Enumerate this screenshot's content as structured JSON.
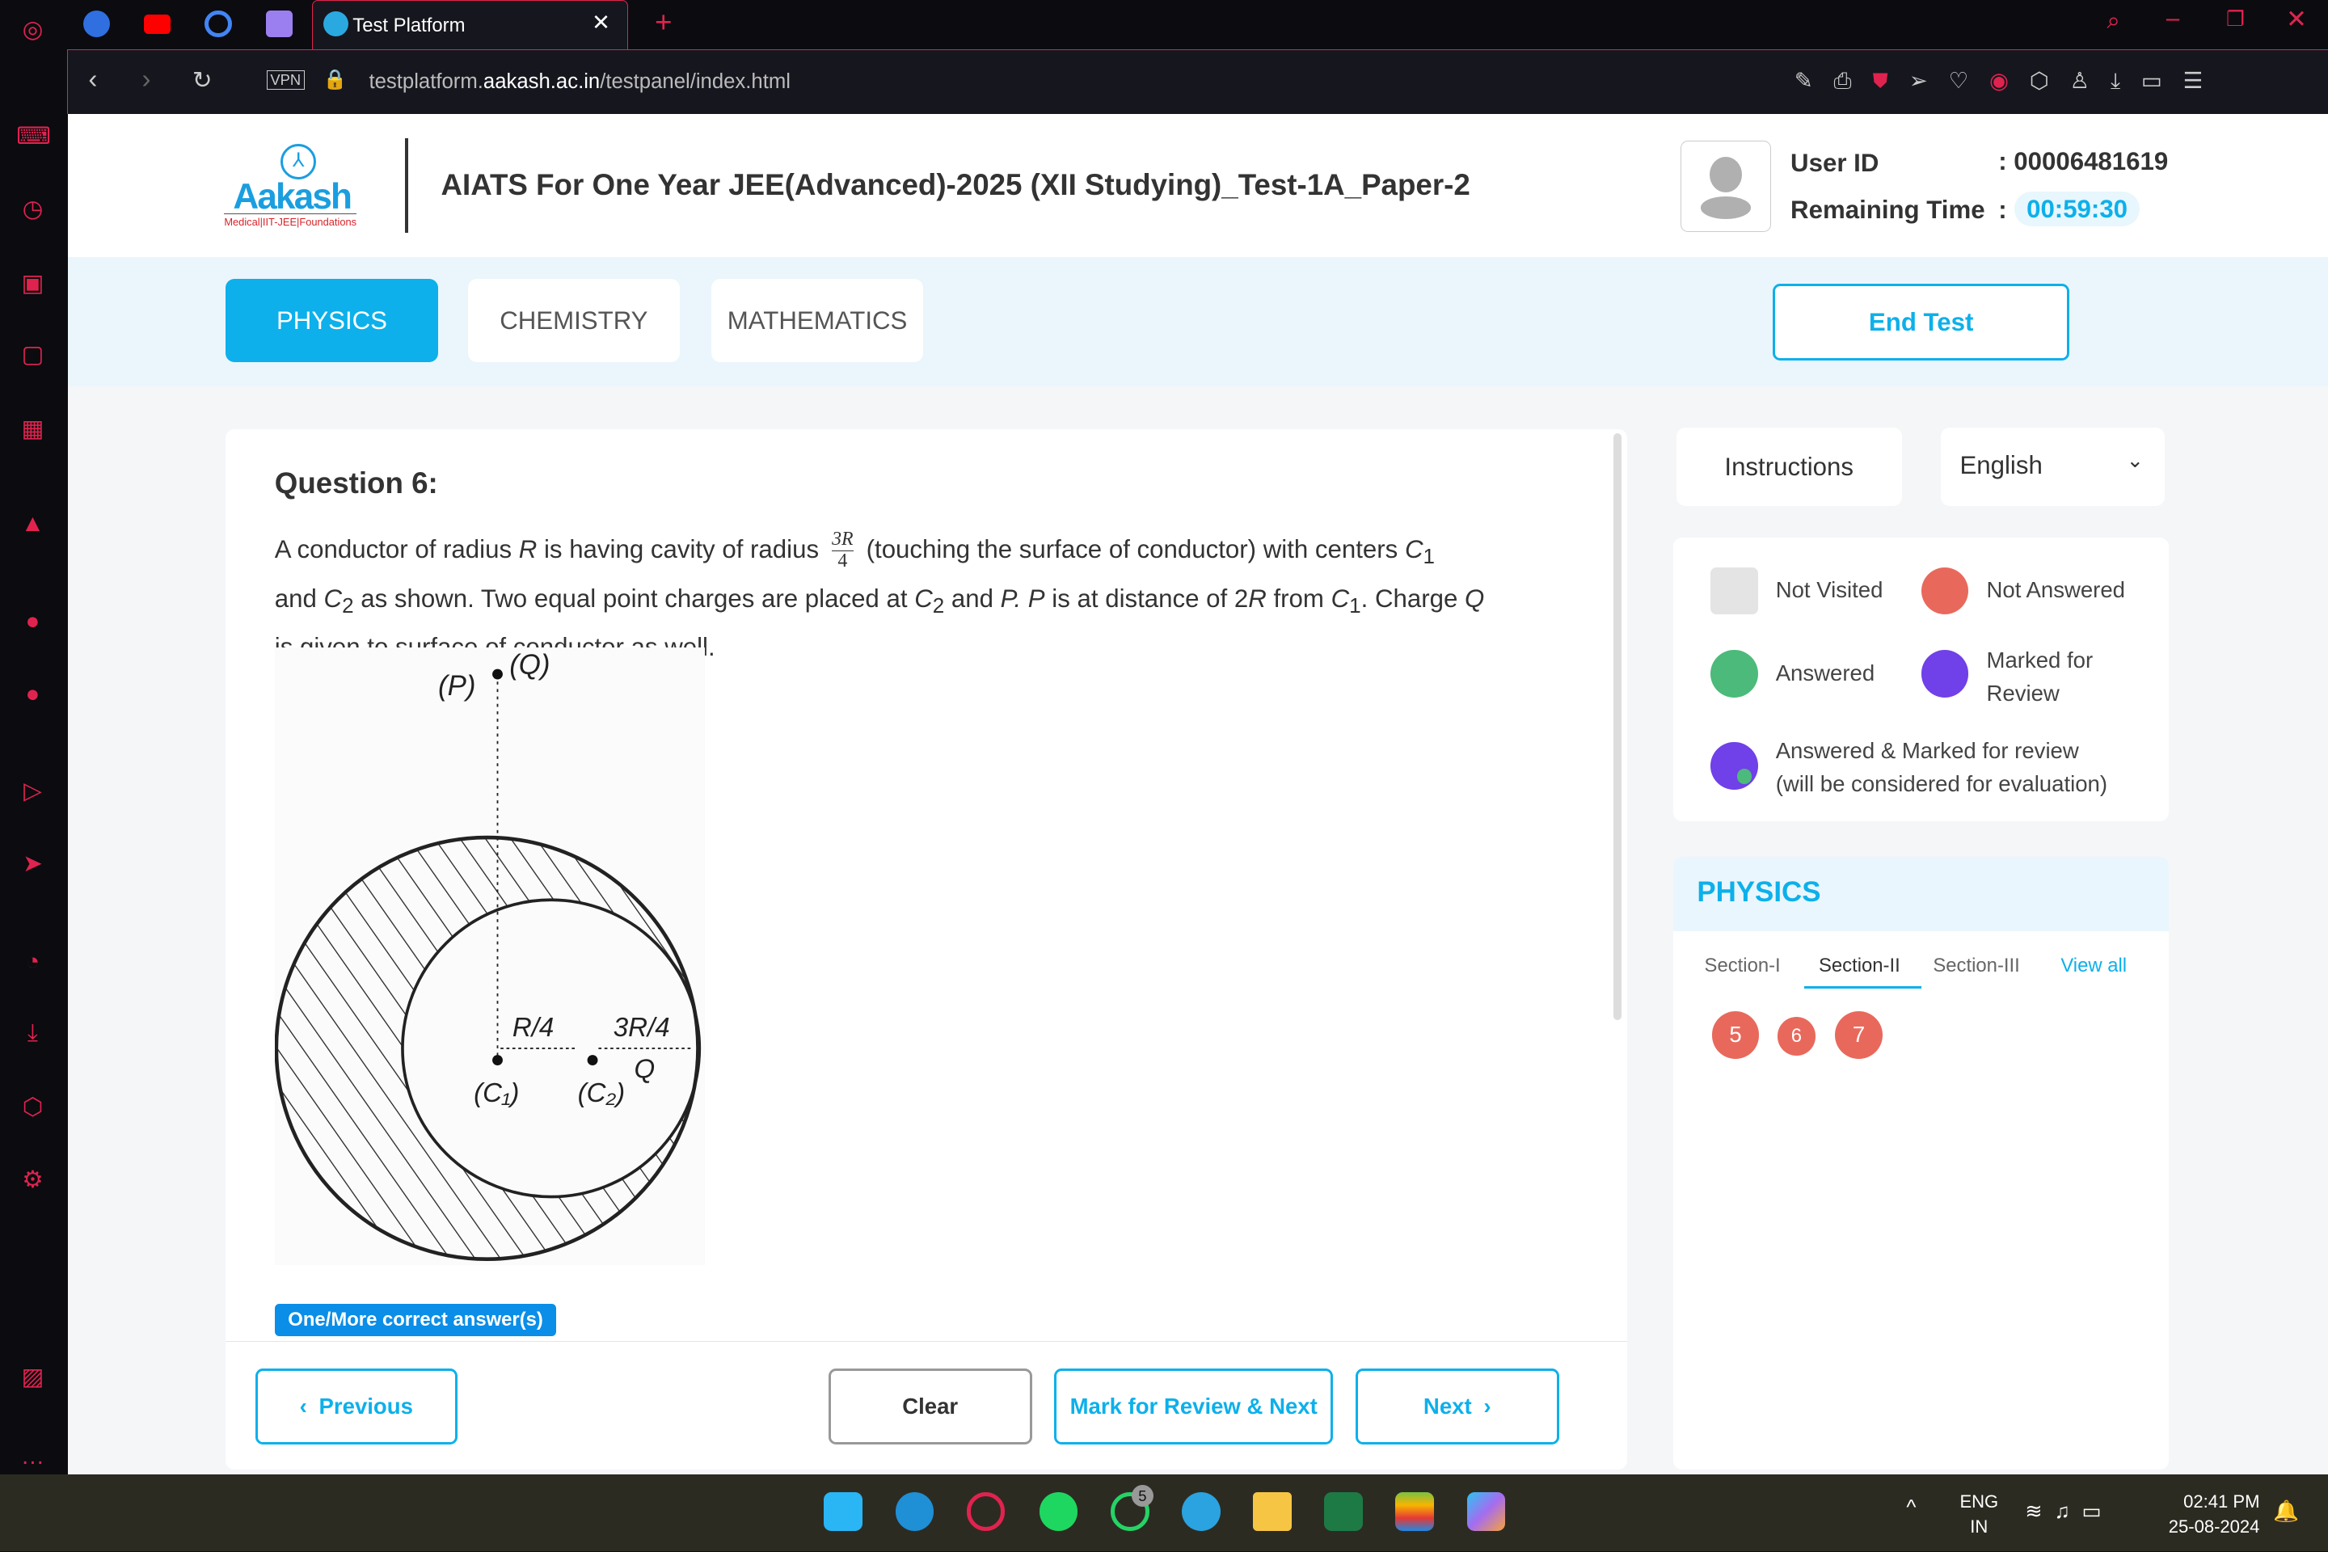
{
  "browser": {
    "tab_title": "Test Platform",
    "url_host": "testplatform.",
    "url_domain": "aakash.ac.in",
    "url_path": "/testpanel/index.html",
    "vpn_label": "VPN"
  },
  "header": {
    "logo_text": "Aakash",
    "logo_tagline": "Medical|IIT-JEE|Foundations",
    "title": "AIATS For One Year JEE(Advanced)-2025 (XII Studying)_Test-1A_Paper-2",
    "user_id_label": "User ID",
    "user_id_value": ": 00006481619",
    "remaining_label": "Remaining Time",
    "remaining_sep": ":",
    "remaining_value": "00:59:30"
  },
  "subjects": [
    {
      "label": "PHYSICS",
      "active": true
    },
    {
      "label": "CHEMISTRY",
      "active": false
    },
    {
      "label": "MATHEMATICS",
      "active": false
    }
  ],
  "end_test_label": "End Test",
  "question": {
    "title": "Question 6:",
    "text_1": "A conductor of radius ",
    "text_R": "R",
    "text_2": " is having cavity of radius ",
    "frac_num": "3R",
    "frac_den": "4",
    "text_3": " (touching the surface of conductor) with centers ",
    "text_C1": "C",
    "sub_1": "1",
    "text_and": "and ",
    "text_C2": "C",
    "sub_2": "2",
    "text_4": " as shown. Two equal point charges are placed at ",
    "text_C2b": "C",
    "sub_2b": "2",
    "text_5": " and ",
    "text_P": "P. P",
    "text_6": " is at distance of 2",
    "text_R2": "R",
    "text_7": " from ",
    "text_C1b": "C",
    "sub_1b": "1",
    "text_8": ". Charge ",
    "text_Q": "Q",
    "text_9": "is given to surface of conductor as well.",
    "diagram_labels": {
      "P": "(P)",
      "Q": "(Q)",
      "r4": "R/4",
      "r34": "3R/4",
      "c1": "(C₁)",
      "c2": "(C₂)",
      "q2": "Q"
    },
    "answer_type": "One/More correct answer(s)"
  },
  "nav": {
    "previous": "Previous",
    "clear": "Clear",
    "mark": "Mark for Review & Next",
    "next": "Next"
  },
  "right": {
    "instructions": "Instructions",
    "language": "English",
    "legend": {
      "not_visited": "Not Visited",
      "not_answered": "Not Answered",
      "answered": "Answered",
      "marked": "Marked for Review",
      "answered_marked": "Answered & Marked for review",
      "answered_marked_note": "(will be considered for evaluation)"
    },
    "palette_title": "PHYSICS",
    "sections": [
      "Section-I",
      "Section-II",
      "Section-III"
    ],
    "active_section": "Section-II",
    "view_all": "View all",
    "questions": [
      "5",
      "6",
      "7"
    ]
  },
  "colors": {
    "accent": "#0db0ea",
    "not_answered": "#e8695c",
    "answered": "#4cba7a",
    "marked": "#7040e8",
    "not_visited": "#e4e4e4"
  },
  "taskbar": {
    "lang1": "ENG",
    "lang2": "IN",
    "time": "02:41 PM",
    "date": "25-08-2024",
    "whatsapp_badge": "5"
  }
}
